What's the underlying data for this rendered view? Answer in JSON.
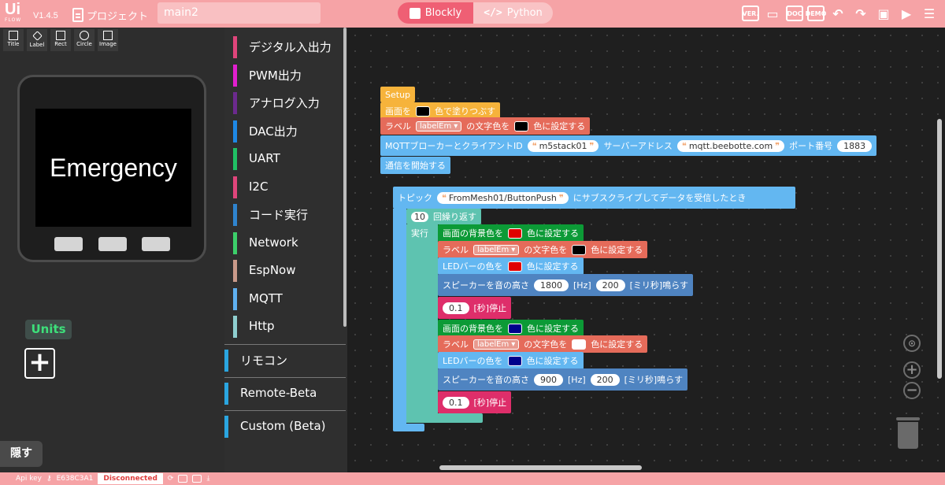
{
  "app": {
    "logo": "Ui",
    "logo_sub": "FLOW",
    "version": "V1.4.5",
    "project_label": "プロジェクト",
    "filename": "main2"
  },
  "modes": {
    "blockly": "Blockly",
    "python": "Python"
  },
  "toolbar_icons": [
    "version-icon",
    "chat-icon",
    "docs-icon",
    "demo-icon",
    "undo-icon",
    "redo-icon",
    "device-icon",
    "run-icon",
    "menu-icon"
  ],
  "toolbar_text": {
    "ver": "VER.",
    "doc": "DOC",
    "demo": "DEMO"
  },
  "tools": [
    "Title",
    "Label",
    "Rect",
    "Circle",
    "Image"
  ],
  "device": {
    "screen_text": "Emergency"
  },
  "units": {
    "title": "Units",
    "add": "+"
  },
  "hide_label": "隠す",
  "categories": [
    {
      "label": "デジタル入出力",
      "color": "#e0457b"
    },
    {
      "label": "PWM出力",
      "color": "#e21fcf"
    },
    {
      "label": "アナログ入力",
      "color": "#6c2a8e"
    },
    {
      "label": "DAC出力",
      "color": "#1e88e5"
    },
    {
      "label": "UART",
      "color": "#20c064"
    },
    {
      "label": "I2C",
      "color": "#e0457b"
    },
    {
      "label": "コード実行",
      "color": "#2f84cf"
    },
    {
      "label": "Network",
      "color": "#3ccf6a"
    },
    {
      "label": "EspNow",
      "color": "#c99a8a"
    },
    {
      "label": "MQTT",
      "color": "#5fb0f0"
    },
    {
      "label": "Http",
      "color": "#8fcfd0"
    }
  ],
  "categories_lower": [
    {
      "label": "リモコン",
      "color": "#2aa5e0"
    },
    {
      "label": "Remote-Beta",
      "color": "#2aa5e0"
    },
    {
      "label": "Custom (Beta)",
      "color": "#2aa5e0"
    }
  ],
  "blocks": {
    "setup": "Setup",
    "fill_pre": "画面を",
    "fill_post": "色で塗りつぶす",
    "label_pre": "ラベル",
    "label_name": "labelEm",
    "label_mid": "の文字色を",
    "label_post": "色に設定する",
    "mqtt_pre": "MQTTブローカーとクライアントID",
    "client_id": "m5stack01",
    "server_label": "サーバーアドレス",
    "server": "mqtt.beebotte.com",
    "port_label": "ポート番号",
    "port": "1883",
    "start_comm": "通信を開始する",
    "topic_pre": "トピック",
    "topic": "FromMesh01/ButtonPush",
    "topic_post": "にサブスクライブしてデータを受信したとき",
    "repeat_count": "10",
    "repeat_label": "回繰り返す",
    "do_label": "実行",
    "bg_pre": "画面の背景色を",
    "bg_post": "色に設定する",
    "led_pre": "LEDバーの色を",
    "led_post": "色に設定する",
    "speaker_pre": "スピーカーを音の高さ",
    "hz": "[Hz]",
    "ms": "[ミリ秒]鳴らす",
    "freq1": "1800",
    "dur1": "200",
    "freq2": "900",
    "dur2": "200",
    "wait_val": "0.1",
    "wait_post": "[秒]停止"
  },
  "colors": {
    "black": "#000000",
    "red": "#e00000",
    "navy": "#00008b",
    "white": "#ffffff"
  },
  "status": {
    "api_key_label": "Api key",
    "api_key": "E638C3A1",
    "state": "Disconnected"
  }
}
